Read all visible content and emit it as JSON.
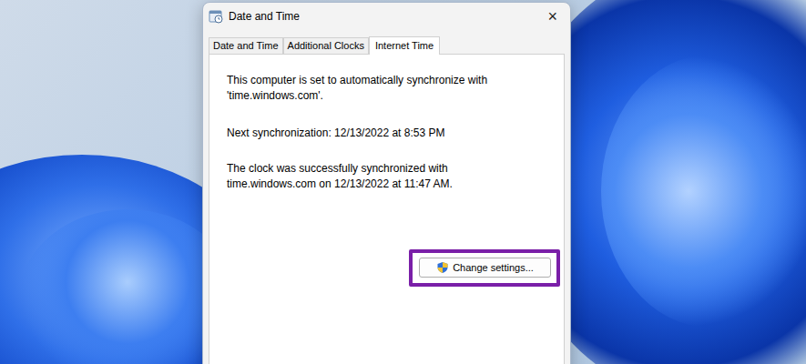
{
  "window": {
    "title": "Date and Time",
    "close": "×"
  },
  "tabs": [
    {
      "label": "Date and Time",
      "selected": false
    },
    {
      "label": "Additional Clocks",
      "selected": false
    },
    {
      "label": "Internet Time",
      "selected": true
    }
  ],
  "content": {
    "sync_info": "This computer is set to automatically synchronize with 'time.windows.com'.",
    "next_sync": "Next synchronization: 12/13/2022 at 8:53 PM",
    "last_sync": "The clock was successfully synchronized with time.windows.com on 12/13/2022 at 11:47 AM."
  },
  "button": {
    "label": "Change settings...",
    "highlighted": true
  }
}
